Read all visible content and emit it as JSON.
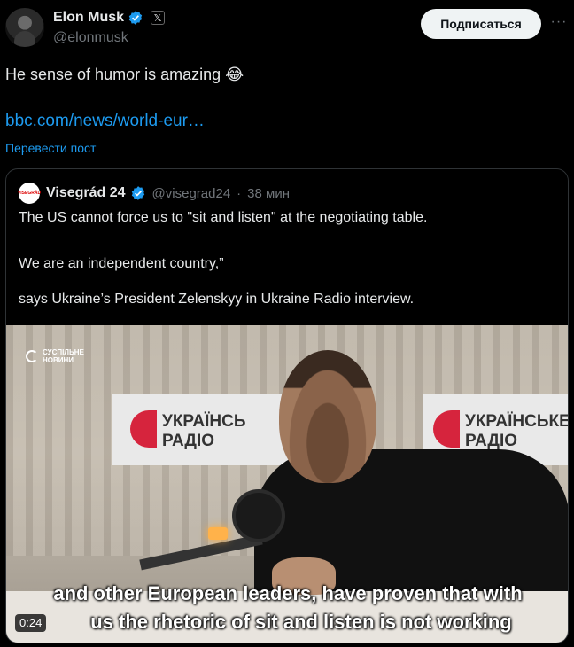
{
  "author": {
    "name": "Elon Musk",
    "handle": "@elonmusk",
    "avatar_icon": "profile-avatar",
    "verified_color": "#1d9bf0",
    "x_badge": "𝕏"
  },
  "actions": {
    "follow_label": "Подписаться",
    "more_label": "···"
  },
  "tweet": {
    "text": "He sense of humor is amazing 😂",
    "link": "bbc.com/news/world-eur…",
    "translate_label": "Перевести пост"
  },
  "quote": {
    "name": "Visegrád 24",
    "handle": "@visegrad24",
    "separator": "·",
    "time": "38 мин",
    "avatar_label": "VISEGRÁD",
    "lines": [
      "The US cannot force us to \"sit and listen\" at the negotiating table.",
      "We are an independent country,”",
      "says Ukraine’s President Zelenskyy in Ukraine Radio interview."
    ],
    "video": {
      "watermark": "СУСПІЛЬНЕ\nНОВИНИ",
      "banner_left": "УКРАЇНСЬ\nРАДІО",
      "banner_right": "УКРАЇНСЬКЕ\nРАДІО",
      "caption_line1": "and other European leaders, have proven that with",
      "caption_line2": "us the rhetoric of sit and listen is not working",
      "duration": "0:24"
    }
  },
  "colors": {
    "background": "#000000",
    "text": "#e7e9ea",
    "muted": "#71767b",
    "link": "#1d9bf0",
    "border": "#2f3336"
  }
}
